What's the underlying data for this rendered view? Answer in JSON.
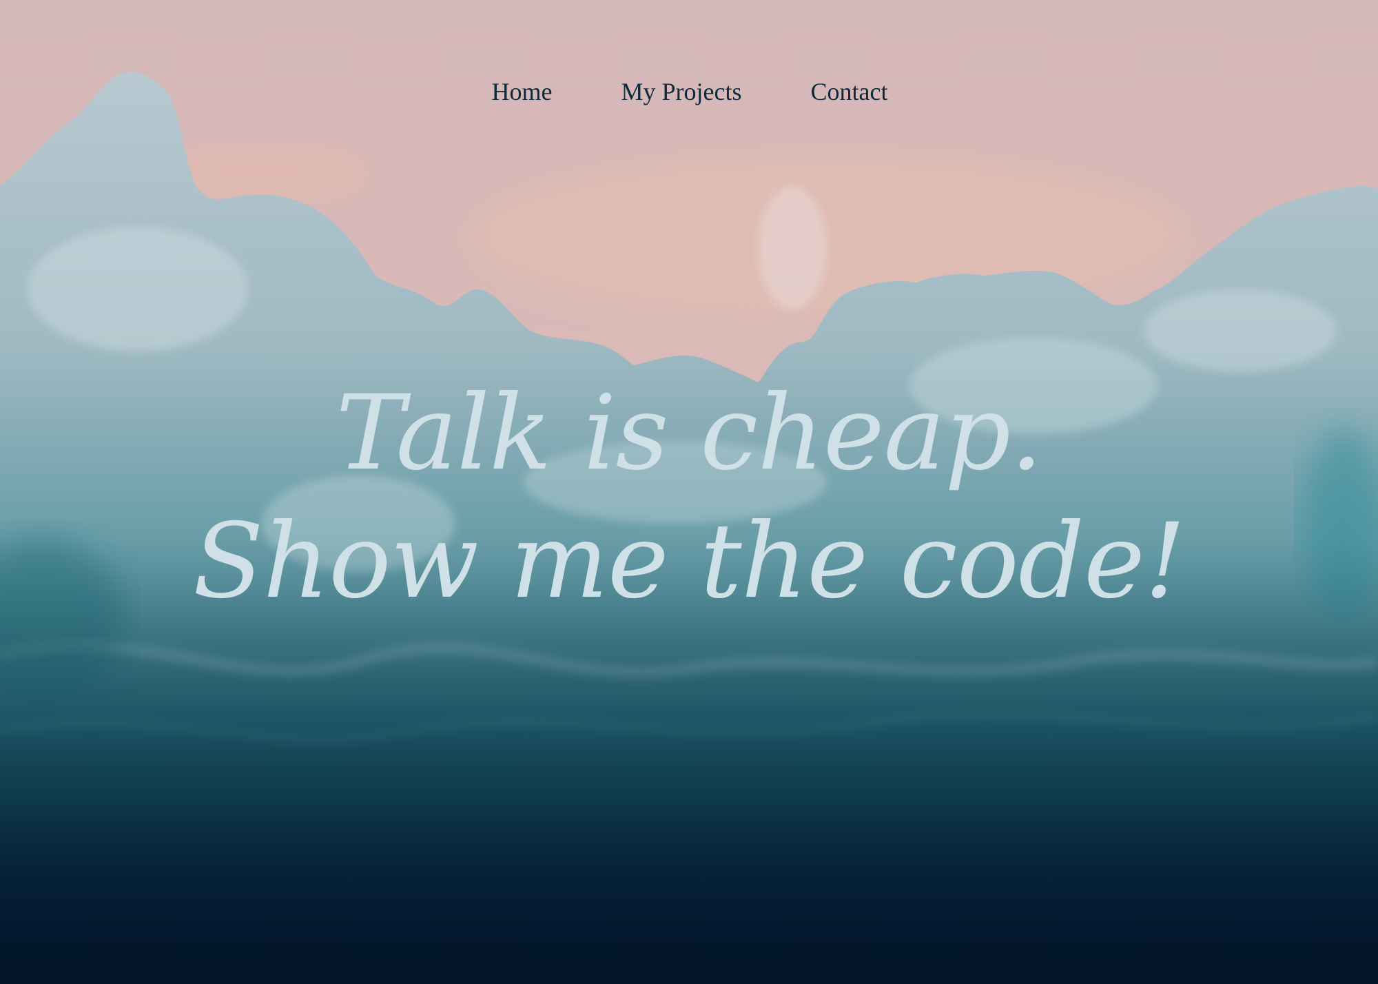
{
  "nav": {
    "items": [
      {
        "label": "Home"
      },
      {
        "label": "My Projects"
      },
      {
        "label": "Contact"
      }
    ]
  },
  "hero": {
    "line1": "Talk is cheap.",
    "line2": "Show me the code!",
    "background": "aerial-beach-waves-photo"
  },
  "colors": {
    "sand": "#d9b8b8",
    "foam": "#a9c4cc",
    "ocean": "#1d6a78",
    "deep": "#041a2c",
    "nav_text": "#0f2a3a",
    "headline_text": "#cfe0e6"
  }
}
